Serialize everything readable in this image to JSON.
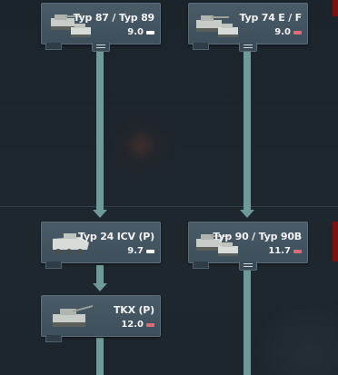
{
  "colors": {
    "connector": "#6f9a9a",
    "card_bg": "#44566a",
    "text": "#f2f2f2",
    "ground_mode_icon": "#ffffff",
    "mixed_mode_icon": "#e06a78"
  },
  "vehicles": [
    {
      "id": "typ87",
      "name": "Typ 87 / Typ 89",
      "br": "9.0",
      "icon": "tank-group-icon",
      "mode_icon": "ground-mode-icon",
      "mode_color": "#ffffff"
    },
    {
      "id": "typ74ef",
      "name": "Typ 74 E / F",
      "br": "9.0",
      "icon": "tank-group-icon",
      "mode_icon": "mixed-mode-icon",
      "mode_color": "#e06a78"
    },
    {
      "id": "typ24",
      "name": "Typ 24 ICV (P)",
      "br": "9.7",
      "icon": "wheeled-vehicle-icon",
      "mode_icon": "ground-mode-icon",
      "mode_color": "#ffffff"
    },
    {
      "id": "typ90",
      "name": "Typ 90 / Typ 90B",
      "br": "11.7",
      "icon": "tank-group-icon",
      "mode_icon": "mixed-mode-icon",
      "mode_color": "#e06a78"
    },
    {
      "id": "tkx",
      "name": "TKX (P)",
      "br": "12.0",
      "icon": "tank-icon",
      "mode_icon": "mixed-mode-icon",
      "mode_color": "#e06a78"
    }
  ]
}
